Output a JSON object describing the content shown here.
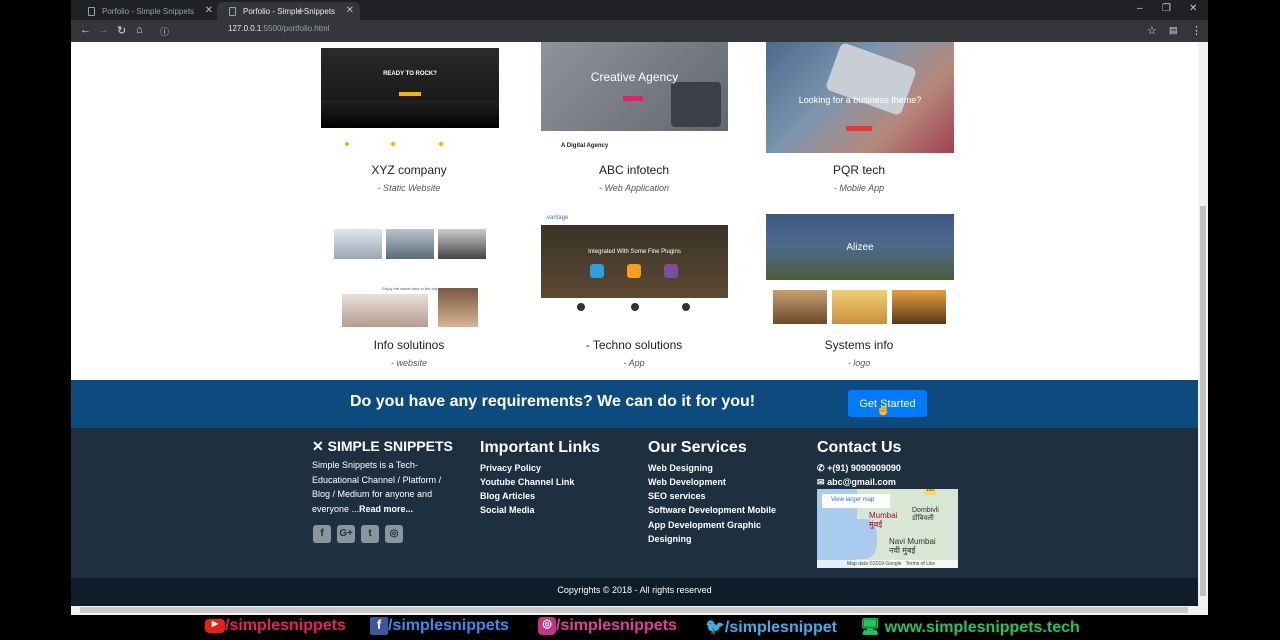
{
  "browser": {
    "tabs": [
      {
        "title": "Porfolio - Simple Snippets",
        "active": false
      },
      {
        "title": "Porfolio - Simple Snippets",
        "active": true
      }
    ],
    "new_tab": "+",
    "url_host": "127.0.0.1",
    "url_rest": ":5500/portfolio.html",
    "win": {
      "min": "–",
      "max": "❐",
      "close": "✕"
    }
  },
  "portfolio": [
    {
      "name": "XYZ company",
      "type": "- Static Website",
      "shot_headline": "READY TO ROCK?"
    },
    {
      "name": "ABC infotech",
      "type": "- Web Application",
      "shot_headline": "Creative Agency",
      "shot_sub": "A Digital Agency"
    },
    {
      "name": "PQR tech",
      "type": "- Mobile App",
      "shot_headline": "Looking for a business theme?"
    },
    {
      "name": "Info solutinos",
      "type": "- website",
      "shot_sub": "Enjoy the winter time in the city"
    },
    {
      "name": "- Techno solutions",
      "type": "- App",
      "shot_headline": "Integrated With Some Fine Plugins",
      "shot_brand": "vantage"
    },
    {
      "name": "Systems info",
      "type": "- logo",
      "shot_headline": "Alizee"
    }
  ],
  "cta": {
    "text": "Do you have any requirements? We can do it for you!",
    "button": "Get Started"
  },
  "footer": {
    "logo": "SIMPLE SNIPPETS",
    "about": "Simple Snippets is a Tech-Educational Channel / Platform / Blog / Medium for anyone and everyone ...",
    "read_more": "Read more...",
    "links_title": "Important Links",
    "links": [
      "Privacy Policy",
      "Youtube Channel Link",
      "Blog Articles",
      "Social Media"
    ],
    "services_title": "Our Services",
    "services": [
      "Web Designing",
      "Web Development",
      "SEO services",
      "Software Development Mobile",
      "App Development Graphic",
      "Designing"
    ],
    "contact_title": "Contact Us",
    "phone": "+(91) 9090909090",
    "email": "abc@gmail.com",
    "map": {
      "link": "View larger map",
      "city1": "Mumbai",
      "city1_local": "मुंबई",
      "city2": "Navi Mumbai",
      "city2_local": "नवी मुंबई",
      "city3": "Dombivli",
      "city3_local": "डोंबिवली",
      "credit": "Map data ©2019 Google",
      "terms": "Terms of Use"
    },
    "copyright": "Copyrights © 2018 - All rights reserved"
  },
  "banner": {
    "youtube": "/simplesnippets",
    "facebook": "/simplesnippets",
    "instagram": "/simplesnippets",
    "twitter": "/simplesnippet",
    "website": "www.simplesnippets.tech"
  }
}
